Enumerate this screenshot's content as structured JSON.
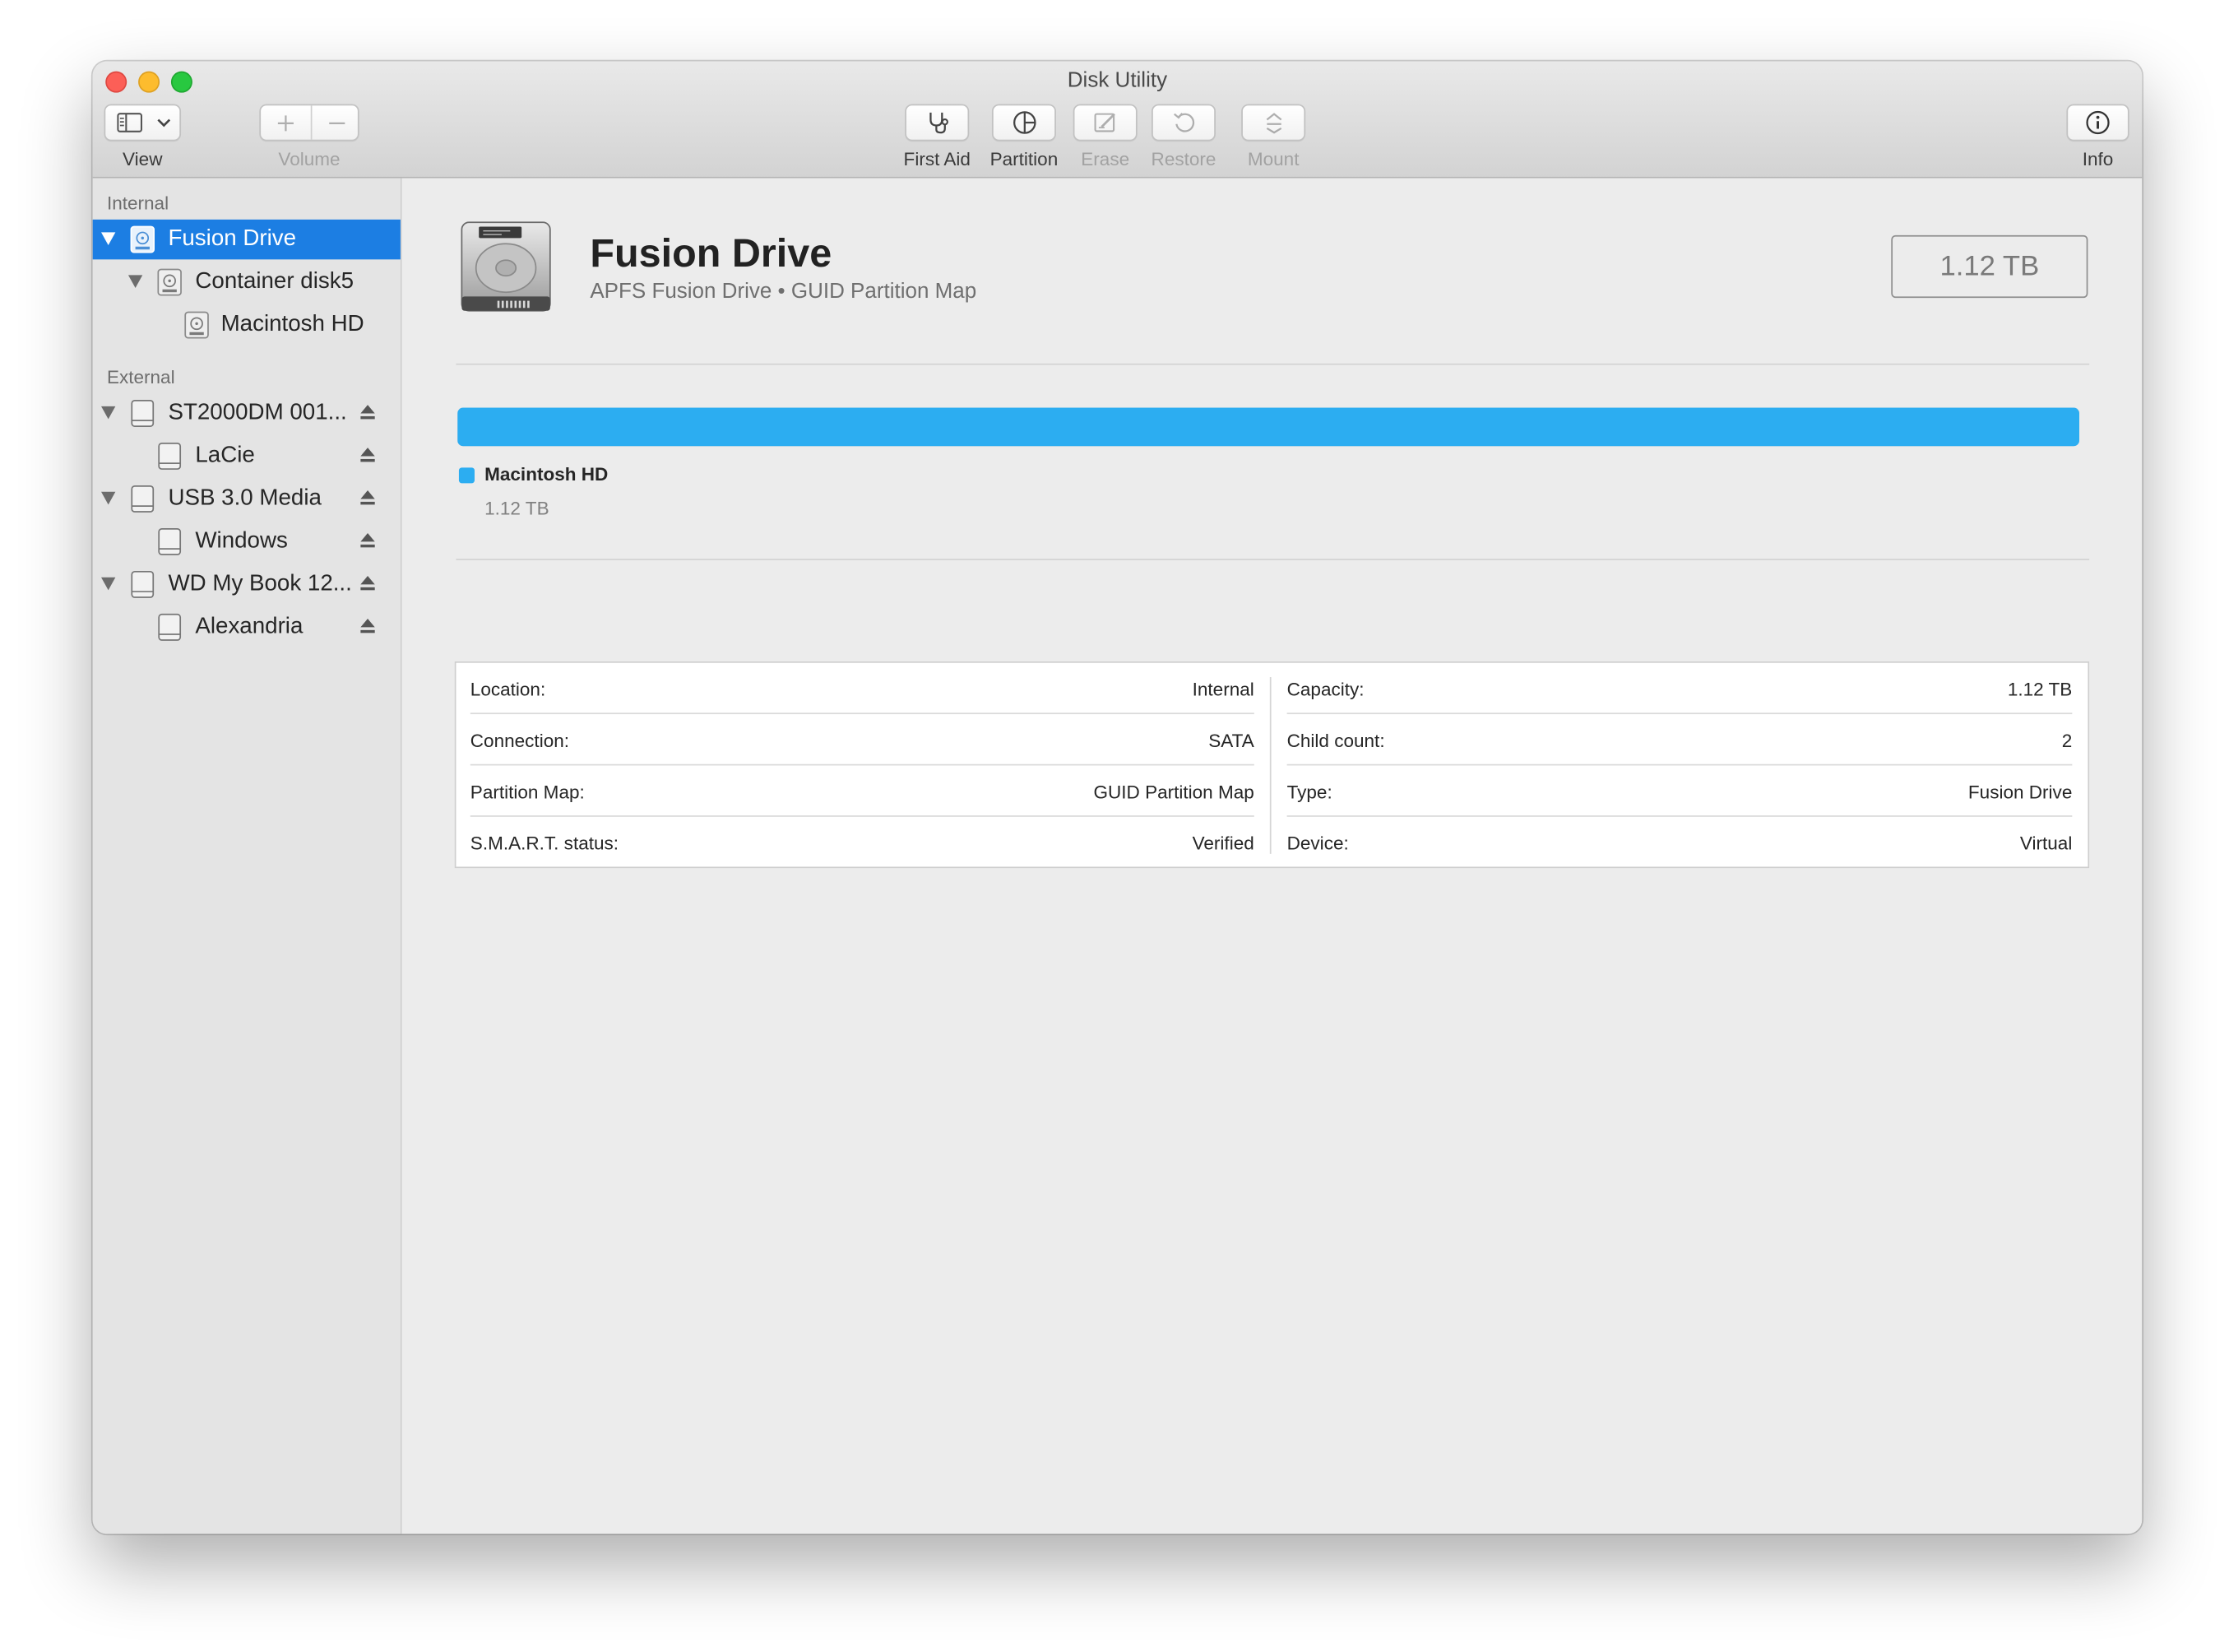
{
  "window": {
    "title": "Disk Utility"
  },
  "toolbar": {
    "view_label": "View",
    "volume_label": "Volume",
    "first_aid_label": "First Aid",
    "partition_label": "Partition",
    "erase_label": "Erase",
    "restore_label": "Restore",
    "mount_label": "Mount",
    "info_label": "Info"
  },
  "sidebar": {
    "internal_header": "Internal",
    "external_header": "External",
    "items": [
      {
        "label": "Fusion Drive",
        "selected": true
      },
      {
        "label": "Container disk5"
      },
      {
        "label": "Macintosh HD"
      },
      {
        "label": "ST2000DM 001..."
      },
      {
        "label": "LaCie"
      },
      {
        "label": "USB 3.0 Media"
      },
      {
        "label": "Windows"
      },
      {
        "label": "WD My Book 12..."
      },
      {
        "label": "Alexandria"
      }
    ]
  },
  "disk": {
    "name": "Fusion Drive",
    "subtitle": "APFS Fusion Drive • GUID Partition Map",
    "capacity": "1.12 TB"
  },
  "usage": {
    "used_fraction": 1.0,
    "color": "#2cadf1",
    "legend_name": "Macintosh HD",
    "legend_size": "1.12 TB"
  },
  "info": {
    "left": [
      {
        "key": "Location:",
        "value": "Internal"
      },
      {
        "key": "Connection:",
        "value": "SATA"
      },
      {
        "key": "Partition Map:",
        "value": "GUID Partition Map"
      },
      {
        "key": "S.M.A.R.T. status:",
        "value": "Verified"
      }
    ],
    "right": [
      {
        "key": "Capacity:",
        "value": "1.12 TB"
      },
      {
        "key": "Child count:",
        "value": "2"
      },
      {
        "key": "Type:",
        "value": "Fusion Drive"
      },
      {
        "key": "Device:",
        "value": "Virtual"
      }
    ]
  },
  "colors": {
    "selection": "#1c7ee3",
    "accent": "#2cadf1"
  }
}
